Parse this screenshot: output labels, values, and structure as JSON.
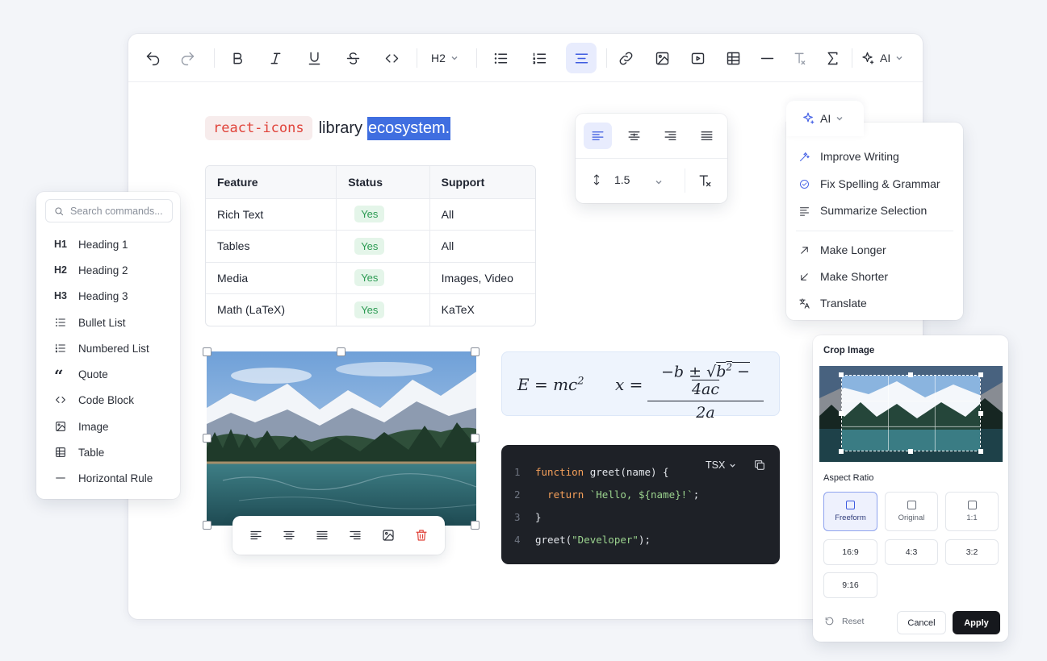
{
  "toolbar": {
    "heading_dropdown": "H2",
    "ai_dropdown": "AI",
    "icons": [
      "undo-icon",
      "redo-icon",
      "bold-icon",
      "italic-icon",
      "underline-icon",
      "strikethrough-icon",
      "code-icon",
      "bullet-list-icon",
      "numbered-list-icon",
      "align-center-icon",
      "link-icon",
      "image-icon",
      "video-icon",
      "table-icon",
      "horizontal-rule-icon",
      "clear-format-icon",
      "sigma-icon",
      "sparkle-icon"
    ]
  },
  "headline": {
    "code": "react-icons",
    "word": "library",
    "selected": "ecosystem."
  },
  "feature_table": {
    "headers": [
      "Feature",
      "Status",
      "Support"
    ],
    "rows": [
      [
        "Rich Text",
        "Yes",
        "All"
      ],
      [
        "Tables",
        "Yes",
        "All"
      ],
      [
        "Media",
        "Yes",
        "Images, Video"
      ],
      [
        "Math (LaTeX)",
        "Yes",
        "KaTeX"
      ]
    ]
  },
  "align_popover": {
    "line_height": "1.5"
  },
  "ai_menu": {
    "tab_label": "AI",
    "items": [
      {
        "label": "Improve Writing",
        "icon": "magic-wand-icon"
      },
      {
        "label": "Fix Spelling & Grammar",
        "icon": "check-circle-icon"
      },
      {
        "label": "Summarize Selection",
        "icon": "summarize-icon"
      },
      {
        "label": "Make Longer",
        "icon": "arrow-up-right-icon"
      },
      {
        "label": "Make Shorter",
        "icon": "arrow-down-left-icon"
      },
      {
        "label": "Translate",
        "icon": "translate-icon"
      }
    ]
  },
  "command_menu": {
    "search_placeholder": "Search commands...",
    "items": [
      {
        "icon_text": "H1",
        "label": "Heading 1"
      },
      {
        "icon_text": "H2",
        "label": "Heading 2"
      },
      {
        "icon_text": "H3",
        "label": "Heading 3"
      },
      {
        "icon_text": "",
        "label": "Bullet List"
      },
      {
        "icon_text": "",
        "label": "Numbered List"
      },
      {
        "icon_text": "“",
        "label": "Quote"
      },
      {
        "icon_text": "",
        "label": "Code Block"
      },
      {
        "icon_text": "",
        "label": "Image"
      },
      {
        "icon_text": "",
        "label": "Table"
      },
      {
        "icon_text": "",
        "label": "Horizontal Rule"
      }
    ]
  },
  "code_block": {
    "language": "TSX",
    "lines": [
      {
        "n": "1",
        "kw": "function",
        "rest": " greet(name) {"
      },
      {
        "n": "2",
        "kw": "return",
        "str": "`Hello, ${name}!`",
        "rest": ";"
      },
      {
        "n": "3",
        "rest": "}"
      },
      {
        "n": "4",
        "pre": "greet(",
        "str": "\"Developer\"",
        "rest": ");"
      }
    ]
  },
  "crop_panel": {
    "title": "Crop Image",
    "aspect_label": "Aspect Ratio",
    "options": [
      "Freeform",
      "Original",
      "1:1",
      "16:9",
      "4:3",
      "3:2",
      "9:16"
    ],
    "selected": "Freeform",
    "reset": "Reset",
    "cancel": "Cancel",
    "apply": "Apply"
  },
  "colors": {
    "accent": "#3d5be0",
    "selection": "#3f6ee0",
    "code_bg": "#1e2127"
  }
}
